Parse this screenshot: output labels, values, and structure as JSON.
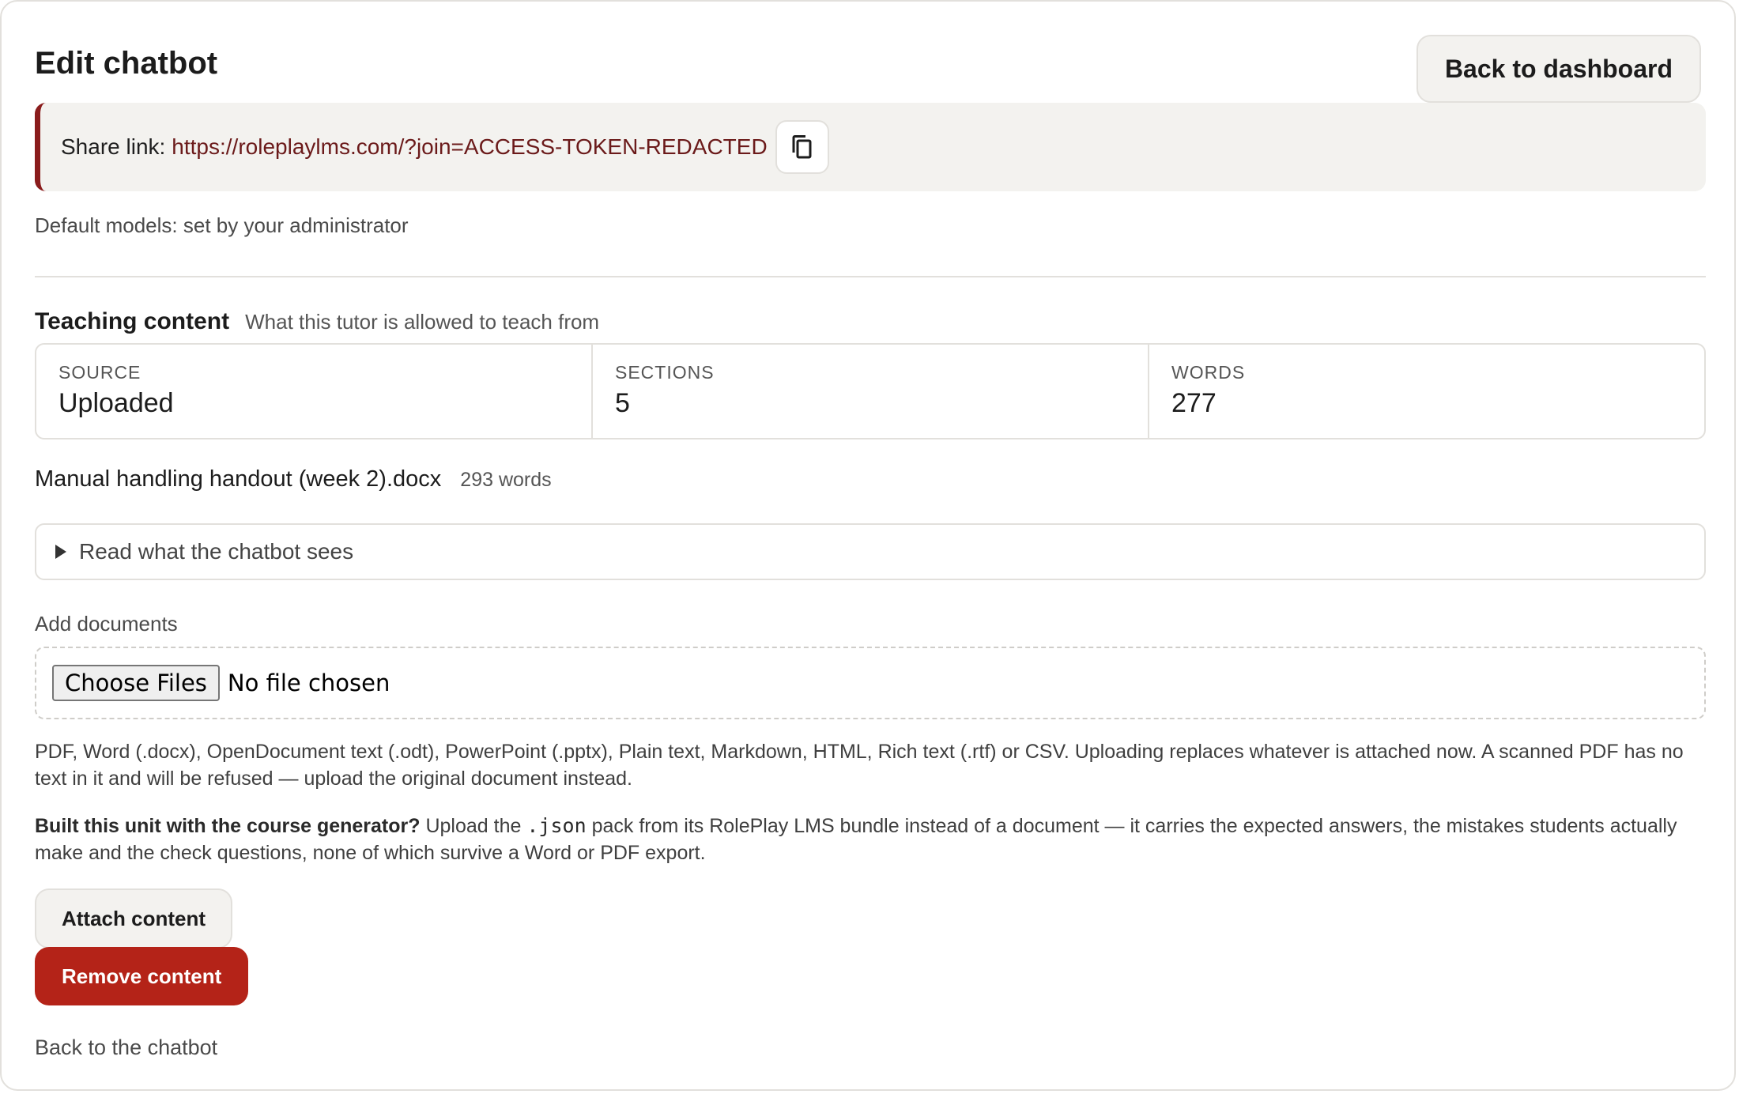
{
  "header": {
    "title": "Edit chatbot",
    "back_label": "Back to dashboard"
  },
  "share": {
    "label": "Share link:",
    "url": "https://roleplaylms.com/?join=ACCESS-TOKEN-REDACTED",
    "copy_icon": "copy-icon"
  },
  "default_models": "Default models: set by your administrator",
  "teaching": {
    "title": "Teaching content",
    "subtitle": "What this tutor is allowed to teach from",
    "stats": [
      {
        "key": "SOURCE",
        "value": "Uploaded"
      },
      {
        "key": "SECTIONS",
        "value": "5"
      },
      {
        "key": "WORDS",
        "value": "277"
      }
    ],
    "file_name": "Manual handling handout (week 2).docx",
    "file_words": "293 words",
    "details_label": "Read what the chatbot sees"
  },
  "upload": {
    "label": "Add documents",
    "choose_label": "Choose Files",
    "no_file": "No file chosen",
    "help": "PDF, Word (.docx), OpenDocument text (.odt), PowerPoint (.pptx), Plain text, Markdown, HTML, Rich text (.rtf) or CSV. Uploading replaces whatever is attached now. A scanned PDF has no text in it and will be refused — upload the original document instead.",
    "tip_bold": "Built this unit with the course generator?",
    "tip_pre": " Upload the ",
    "tip_code": ".json",
    "tip_post": " pack from its RolePlay LMS bundle instead of a document — it carries the expected answers, the mistakes students actually make and the check questions, none of which survive a Word or PDF export."
  },
  "actions": {
    "attach_label": "Attach content",
    "remove_label": "Remove content",
    "back_chatbot": "Back to the chatbot"
  },
  "colors": {
    "accent": "#8a1c1c",
    "danger": "#b42318",
    "panel": "#f3f2ef"
  }
}
